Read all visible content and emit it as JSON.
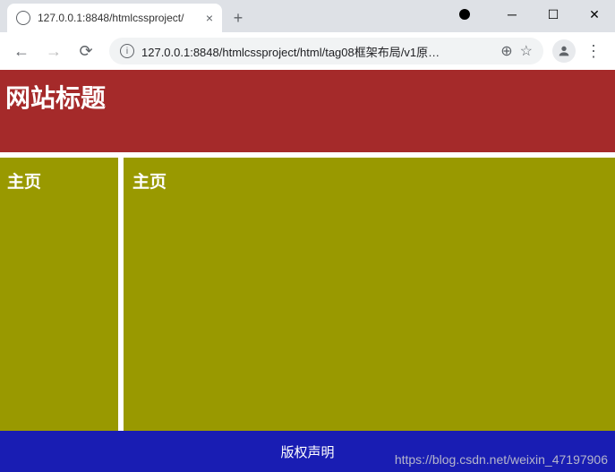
{
  "browser": {
    "tab": {
      "title": "127.0.0.1:8848/htmlcssproject/"
    },
    "address": "127.0.0.1:8848/htmlcssproject/html/tag08框架布局/v1原…"
  },
  "page": {
    "header_title": "网站标题",
    "side_heading": "主页",
    "main_heading": "主页",
    "footer": "版权声明"
  },
  "watermark": "https://blog.csdn.net/weixin_47197906"
}
